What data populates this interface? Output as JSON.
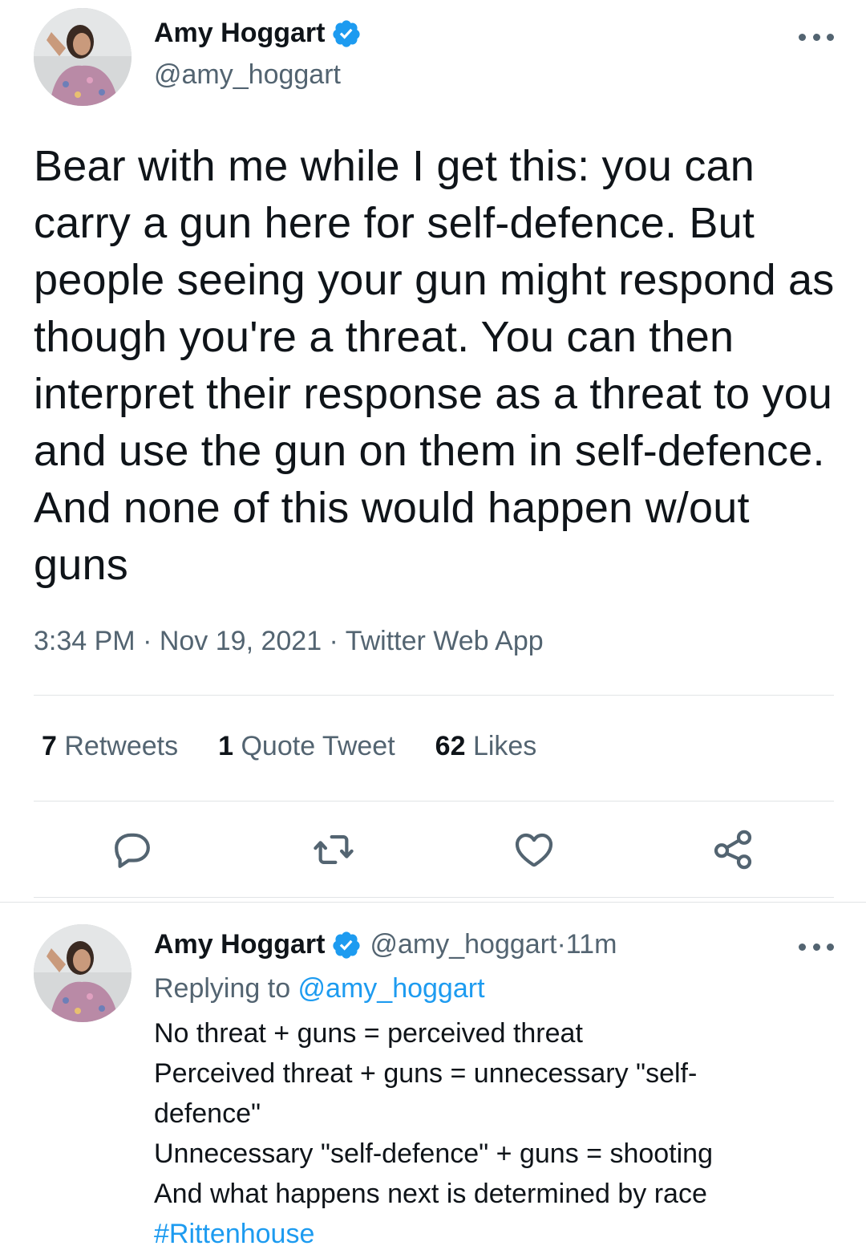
{
  "tweet": {
    "author_name": "Amy Hoggart",
    "author_handle": "@amy_hoggart",
    "text": "Bear with me while I get this: you can carry a gun here for self-defence. But people seeing your gun might respond as though you're a threat. You can then interpret their response as a threat to you and use the gun on them in self-defence. And none of this would happen w/out guns",
    "time": "3:34 PM",
    "separator": " · ",
    "date": "Nov 19, 2021",
    "source": "Twitter Web App",
    "retweets_count": "7",
    "retweets_label": "Retweets",
    "quotes_count": "1",
    "quotes_label": "Quote Tweet",
    "likes_count": "62",
    "likes_label": "Likes"
  },
  "reply": {
    "author_name": "Amy Hoggart",
    "author_handle": "@amy_hoggart",
    "separator": " · ",
    "age": "11m",
    "replying_to_label": "Replying to ",
    "replying_to_handle": "@amy_hoggart",
    "lines": [
      "No threat + guns = perceived threat",
      "Perceived threat + guns = unnecessary \"self-defence\"",
      "Unnecessary \"self-defence\" + guns = shooting",
      "And what happens next is determined by race"
    ],
    "hashtag": "#Rittenhouse"
  },
  "icons": {
    "verified": "verified-badge-icon",
    "more": "more-options-icon",
    "reply": "reply-icon",
    "retweet": "retweet-icon",
    "like": "heart-icon",
    "share": "share-icon"
  },
  "colors": {
    "accent": "#1d9bf0",
    "text": "#0f1419",
    "secondary": "#536471",
    "divider": "#e1e4e6"
  }
}
